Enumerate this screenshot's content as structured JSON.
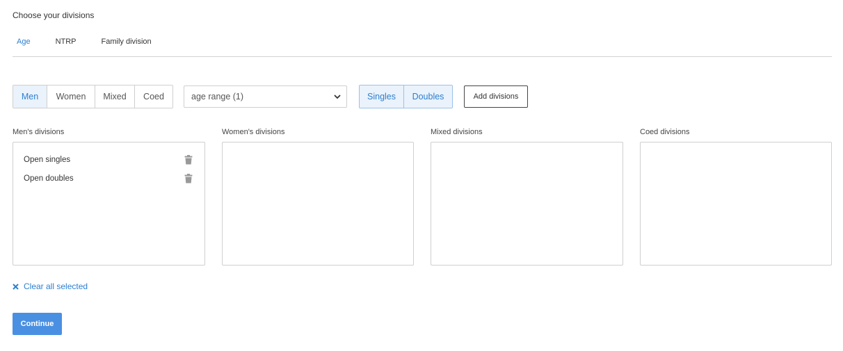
{
  "heading": "Choose your divisions",
  "tabs": [
    {
      "label": "Age",
      "active": true
    },
    {
      "label": "NTRP",
      "active": false
    },
    {
      "label": "Family division",
      "active": false
    }
  ],
  "gender_filter": {
    "options": [
      "Men",
      "Women",
      "Mixed",
      "Coed"
    ],
    "selected": "Men"
  },
  "age_select": {
    "value": "age range (1)",
    "icon": "chevron-down-icon"
  },
  "type_filter": {
    "options": [
      "Singles",
      "Doubles"
    ],
    "selected": [
      "Singles",
      "Doubles"
    ]
  },
  "add_button": "Add divisions",
  "columns": [
    {
      "title": "Men's divisions",
      "items": [
        "Open singles",
        "Open doubles"
      ]
    },
    {
      "title": "Women's divisions",
      "items": []
    },
    {
      "title": "Mixed divisions",
      "items": []
    },
    {
      "title": "Coed divisions",
      "items": []
    }
  ],
  "clear_all": {
    "label": "Clear all selected",
    "icon": "close-icon"
  },
  "continue_button": "Continue",
  "colors": {
    "accent": "#2c7fd0",
    "primary_button": "#4a90e2",
    "selected_bg": "#eaf2fb"
  }
}
